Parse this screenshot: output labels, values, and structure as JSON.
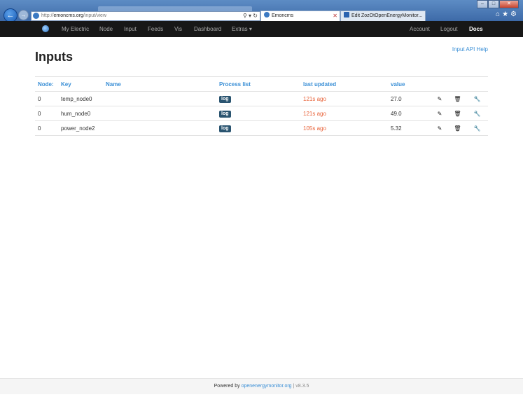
{
  "browser": {
    "address_scheme": "http://",
    "address_host": "emoncms.org",
    "address_path": "/input/view",
    "tabs": [
      {
        "label": "Emoncms"
      },
      {
        "label": "Edit ZozOtOpenEnergyMonitor..."
      }
    ]
  },
  "nav": {
    "items": [
      "My Electric",
      "Node",
      "Input",
      "Feeds",
      "Vis",
      "Dashboard",
      "Extras"
    ],
    "right": [
      "Account",
      "Logout",
      "Docs"
    ]
  },
  "page": {
    "title": "Inputs",
    "help_link": "Input API Help"
  },
  "table": {
    "headers": [
      "Node:",
      "Key",
      "Name",
      "Process list",
      "last updated",
      "value"
    ],
    "rows": [
      {
        "node": "0",
        "key": "temp_node0",
        "name": "",
        "process": "log",
        "updated": "121s ago",
        "value": "27.0"
      },
      {
        "node": "0",
        "key": "hum_node0",
        "name": "",
        "process": "log",
        "updated": "121s ago",
        "value": "49.0"
      },
      {
        "node": "0",
        "key": "power_node2",
        "name": "",
        "process": "log",
        "updated": "105s ago",
        "value": "5.32"
      }
    ]
  },
  "footer": {
    "prefix": "Powered by ",
    "link": "openenergymonitor.org",
    "version": " | v8.3.5"
  },
  "colors": {
    "navbar": "#171717",
    "link_blue": "#3a8fd6",
    "updated_orange": "#e8633a",
    "label_bg": "#2a5470"
  },
  "icons": [
    "pencil-icon",
    "trash-icon",
    "wrench-icon",
    "back-arrow-icon",
    "forward-arrow-icon",
    "home-icon",
    "star-icon",
    "gear-icon"
  ]
}
